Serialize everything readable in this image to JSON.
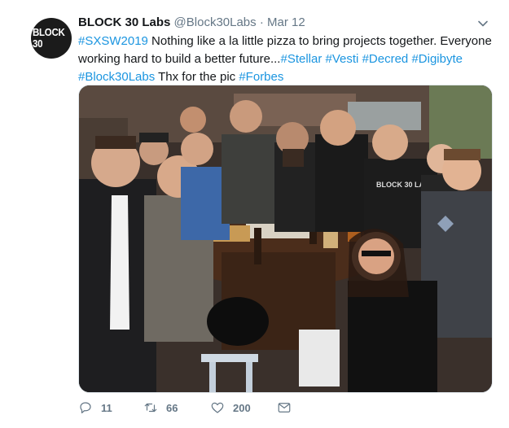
{
  "tweet": {
    "avatar_text": "BLOCK 30",
    "display_name": "BLOCK 30 Labs",
    "handle": "@Block30Labs",
    "separator": "·",
    "date": "Mar 12",
    "text_segments": [
      {
        "text": "#SXSW2019",
        "type": "hashtag"
      },
      {
        "text": " Nothing like a la little pizza to bring projects together. Everyone working hard to build a better future...",
        "type": "plain"
      },
      {
        "text": "#Stellar",
        "type": "hashtag"
      },
      {
        "text": " ",
        "type": "plain"
      },
      {
        "text": "#Vesti",
        "type": "hashtag"
      },
      {
        "text": " ",
        "type": "plain"
      },
      {
        "text": "#Decred",
        "type": "hashtag"
      },
      {
        "text": " ",
        "type": "plain"
      },
      {
        "text": "#Digibyte",
        "type": "hashtag"
      },
      {
        "text": " ",
        "type": "plain"
      },
      {
        "text": "#Block30Labs",
        "type": "hashtag"
      },
      {
        "text": " Thx for the pic ",
        "type": "plain"
      },
      {
        "text": "#Forbes",
        "type": "hashtag"
      }
    ],
    "photo": {
      "shirt_text": "BLOCK 30 LABS",
      "icon": "group-photo-image"
    },
    "actions": {
      "reply_count": "11",
      "retweet_count": "66",
      "like_count": "200"
    }
  },
  "colors": {
    "link": "#1b95e0",
    "secondary_text": "#657786",
    "primary_text": "#14171a"
  },
  "icons": [
    "chevron-down-icon",
    "reply-icon",
    "retweet-icon",
    "like-icon",
    "dm-icon"
  ]
}
